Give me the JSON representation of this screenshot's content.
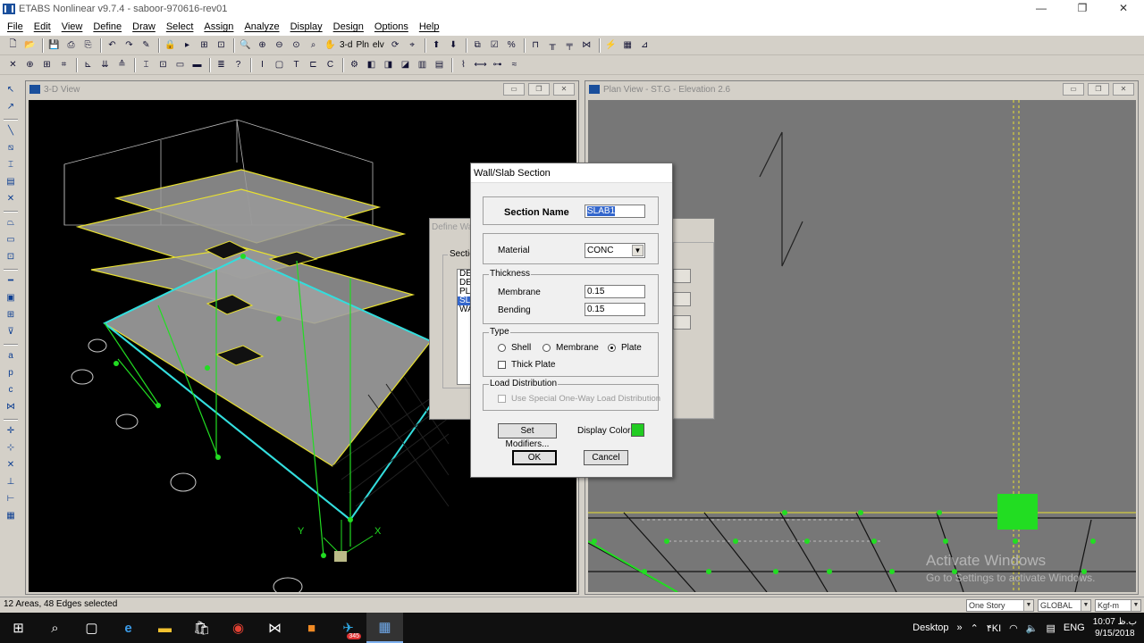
{
  "app": {
    "title": "ETABS Nonlinear v9.7.4 - saboor-970616-rev01",
    "window_controls": [
      "—",
      "❐",
      "✕"
    ]
  },
  "menu": [
    "File",
    "Edit",
    "View",
    "Define",
    "Draw",
    "Select",
    "Assign",
    "Analyze",
    "Display",
    "Design",
    "Options",
    "Help"
  ],
  "toolbar": {
    "text_3d": "3-d",
    "text_pln": "Pln",
    "text_elv": "elv"
  },
  "windows": {
    "view3d": {
      "title": "3-D View"
    },
    "plan": {
      "title": "Plan View - ST.G - Elevation 2.6"
    }
  },
  "define_dialog": {
    "title": "Define Wa",
    "group_label": "Sectio",
    "list": [
      "DE",
      "DE",
      "PLA",
      "SLA",
      "WA"
    ],
    "selected_index": 3
  },
  "slab_dialog": {
    "title": "Wall/Slab Section",
    "section_name_label": "Section Name",
    "section_name_value": "SLAB1",
    "material_label": "Material",
    "material_value": "CONC",
    "thickness_label": "Thickness",
    "membrane_label": "Membrane",
    "membrane_value": "0.15",
    "bending_label": "Bending",
    "bending_value": "0.15",
    "type_label": "Type",
    "type_shell": "Shell",
    "type_membrane": "Membrane",
    "type_plate": "Plate",
    "type_selected": "Plate",
    "thick_plate_label": "Thick Plate",
    "load_dist_label": "Load Distribution",
    "one_way_label": "Use Special One-Way Load Distribution",
    "set_modifiers_label": "Set Modifiers...",
    "display_color_label": "Display Color",
    "display_color": "#22cc22",
    "ok_label": "OK",
    "cancel_label": "Cancel"
  },
  "statusbar": {
    "text": "12 Areas, 48 Edges selected",
    "story_mode": "One Story",
    "coord_system": "GLOBAL",
    "units": "Kgf-m"
  },
  "watermark": {
    "line1": "Activate Windows",
    "line2": "Go to Settings to activate Windows."
  },
  "taskbar": {
    "desktop_label": "Desktop",
    "chevron": "»",
    "language": "ENG",
    "time": "10:07 ب.ظ",
    "date": "9/15/2018",
    "badge": "345",
    "keyboard_label": "۴KI"
  },
  "colors": {
    "grid_yellow": "#e8e030",
    "node_green": "#22dd22",
    "selection_cyan": "#33dddd",
    "slab_gray": "#9a9a9a"
  }
}
